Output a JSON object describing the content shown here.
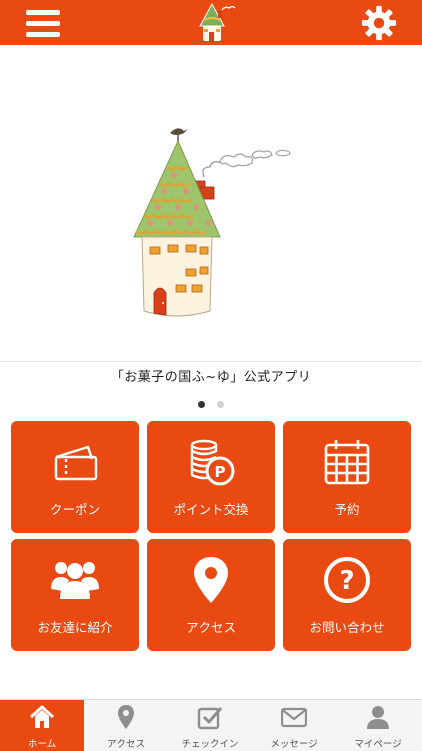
{
  "colors": {
    "accent": "#e84a12",
    "tab_icon_inactive": "#8e8e8e"
  },
  "header": {
    "menu_icon": "hamburger-menu-icon",
    "logo_icon": "house-logo",
    "settings_icon": "gear-icon"
  },
  "hero": {
    "image": "watercolor-house-with-chimney-illustration",
    "caption": "「お菓子の国ふ~ゆ」公式アプリ",
    "slide_current": 1,
    "slide_total": 2
  },
  "menu": {
    "tiles": [
      {
        "label": "クーポン",
        "icon": "ticket-icon"
      },
      {
        "label": "ポイント交換",
        "icon": "coins-point-icon"
      },
      {
        "label": "予約",
        "icon": "calendar-icon"
      },
      {
        "label": "お友達に紹介",
        "icon": "people-icon"
      },
      {
        "label": "アクセス",
        "icon": "map-pin-icon"
      },
      {
        "label": "お問い合わせ",
        "icon": "question-circle-icon"
      }
    ]
  },
  "tabbar": {
    "tabs": [
      {
        "label": "ホーム",
        "icon": "home-icon",
        "active": true
      },
      {
        "label": "アクセス",
        "icon": "map-pin-icon",
        "active": false
      },
      {
        "label": "チェックイン",
        "icon": "checkin-icon",
        "active": false
      },
      {
        "label": "メッセージ",
        "icon": "envelope-icon",
        "active": false
      },
      {
        "label": "マイページ",
        "icon": "user-icon",
        "active": false
      }
    ]
  }
}
